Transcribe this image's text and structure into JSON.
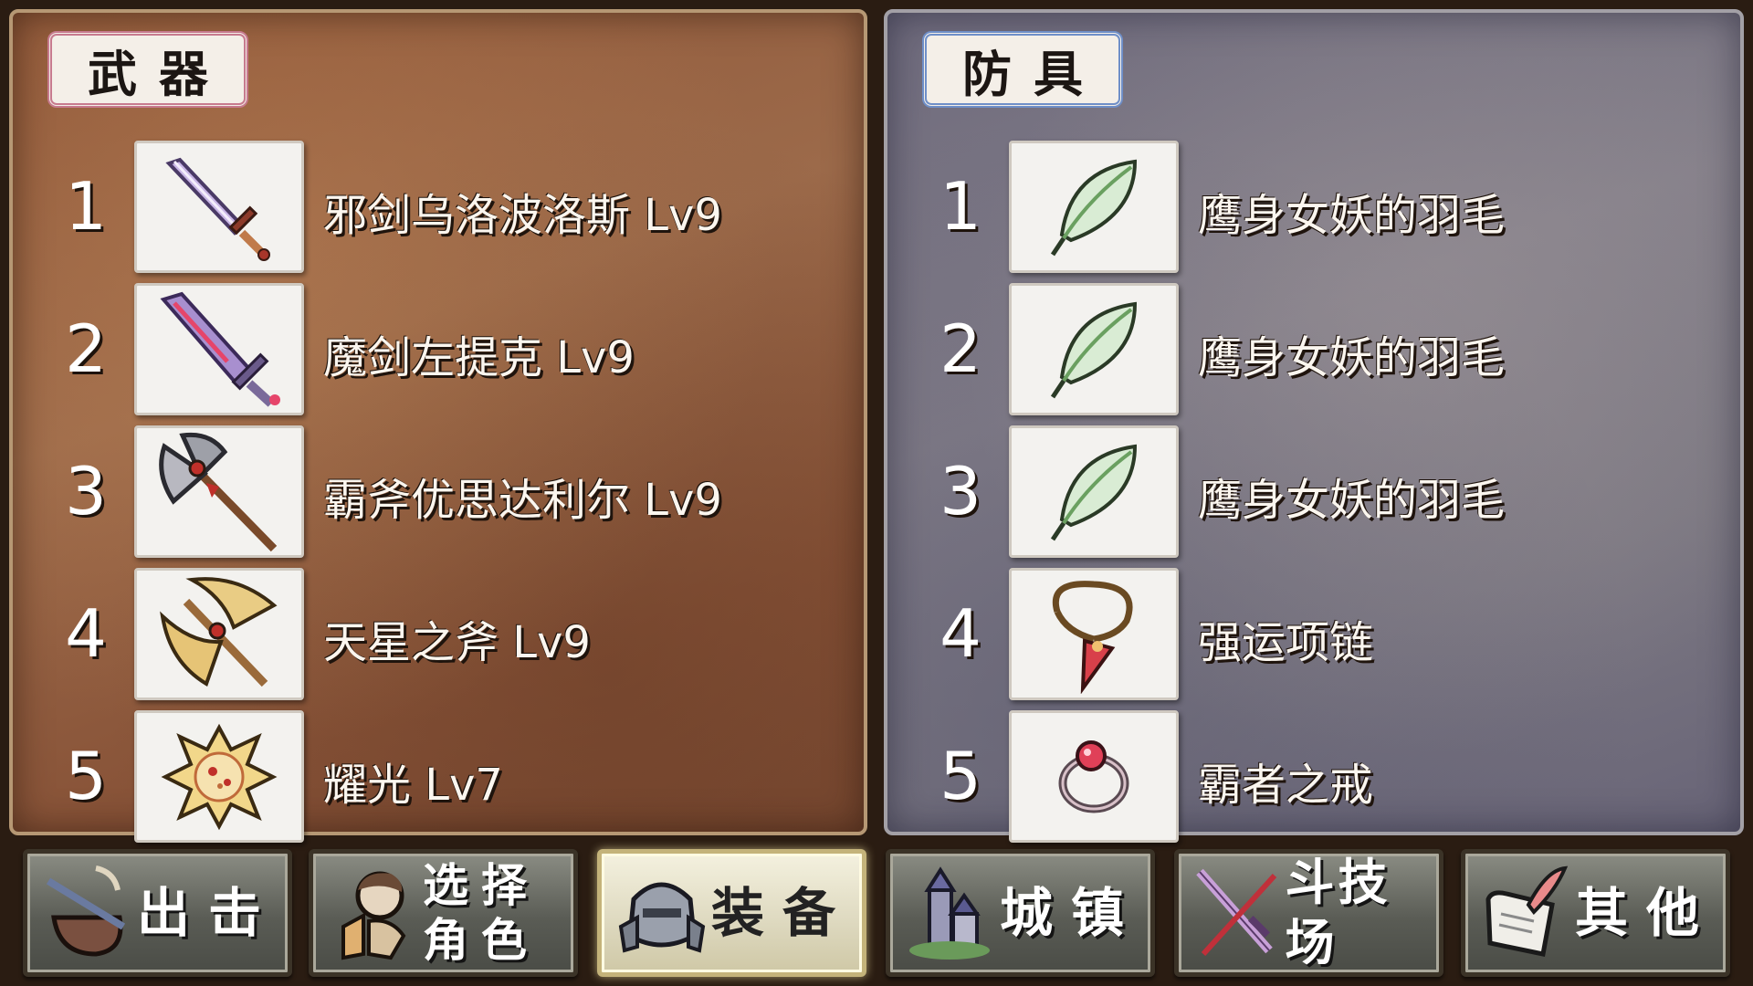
{
  "weapons_panel": {
    "title": "武器",
    "items": [
      {
        "num": "1",
        "name": "邪剑乌洛波洛斯 Lv9",
        "icon": "purple-sword-icon"
      },
      {
        "num": "2",
        "name": "魔剑左提克 Lv9",
        "icon": "demon-sword-icon"
      },
      {
        "num": "3",
        "name": "霸斧优思达利尔 Lv9",
        "icon": "battle-axe-icon"
      },
      {
        "num": "4",
        "name": "天星之斧 Lv9",
        "icon": "golden-axe-icon"
      },
      {
        "num": "5",
        "name": "耀光 Lv7",
        "icon": "radiant-orb-icon"
      }
    ]
  },
  "armor_panel": {
    "title": "防具",
    "items": [
      {
        "num": "1",
        "name": "鹰身女妖的羽毛",
        "icon": "feather-icon"
      },
      {
        "num": "2",
        "name": "鹰身女妖的羽毛",
        "icon": "feather-icon"
      },
      {
        "num": "3",
        "name": "鹰身女妖的羽毛",
        "icon": "feather-icon"
      },
      {
        "num": "4",
        "name": "强运项链",
        "icon": "necklace-icon"
      },
      {
        "num": "5",
        "name": "霸者之戒",
        "icon": "ring-icon"
      }
    ]
  },
  "nav": {
    "sortie": "出击",
    "select_character": "选择\n角色",
    "equipment": "装备",
    "town": "城镇",
    "arena": "斗技场",
    "other": "其他",
    "active": "equipment"
  }
}
